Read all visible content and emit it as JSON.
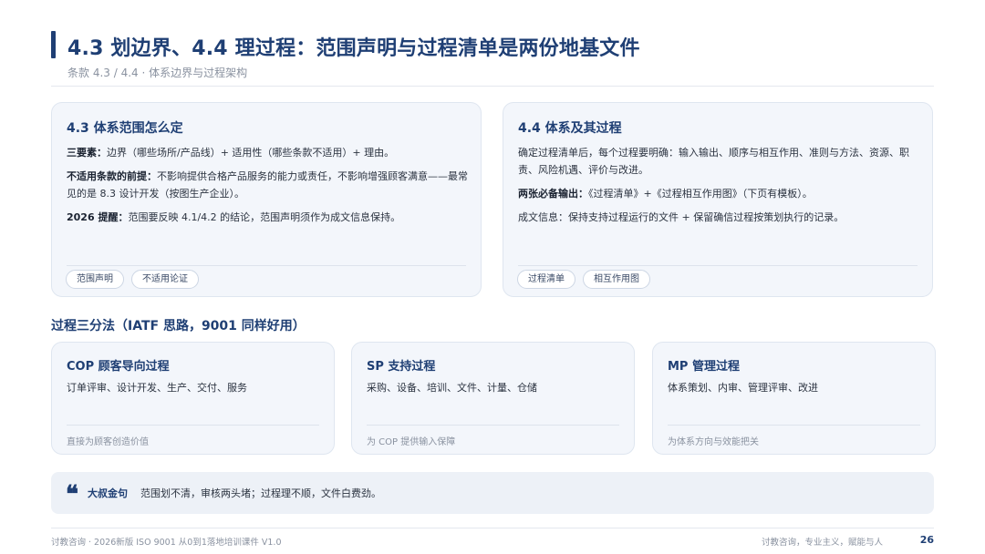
{
  "header": {
    "title": "4.3 划边界、4.4 理过程：范围声明与过程清单是两份地基文件",
    "subtitle": "条款 4.3 / 4.4 · 体系边界与过程架构"
  },
  "card_scope": {
    "title": "4.3 体系范围怎么定",
    "p1_label": "三要素：",
    "p1_text": "边界（哪些场所/产品线）+ 适用性（哪些条款不适用）+ 理由。",
    "p2_label": "不适用条款的前提：",
    "p2_text": "不影响提供合格产品服务的能力或责任，不影响增强顾客满意——最常见的是 8.3 设计开发（按图生产企业）。",
    "p3_label": "2026 提醒：",
    "p3_text": "范围要反映 4.1/4.2 的结论，范围声明须作为成文信息保持。",
    "tags": [
      "范围声明",
      "不适用论证"
    ]
  },
  "card_process": {
    "title": "4.4 体系及其过程",
    "p1_text": "确定过程清单后，每个过程要明确：输入输出、顺序与相互作用、准则与方法、资源、职责、风险机遇、评价与改进。",
    "p2_label": "两张必备输出：",
    "p2_text": "《过程清单》+《过程相互作用图》（下页有模板）。",
    "p3_text": "成文信息：保持支持过程运行的文件 + 保留确信过程按策划执行的记录。",
    "tags": [
      "过程清单",
      "相互作用图"
    ]
  },
  "section": {
    "heading": "过程三分法（IATF 思路，9001 同样好用）"
  },
  "process_types": [
    {
      "title": "COP 顾客导向过程",
      "desc": "订单评审、设计开发、生产、交付、服务",
      "foot": "直接为顾客创造价值"
    },
    {
      "title": "SP 支持过程",
      "desc": "采购、设备、培训、文件、计量、仓储",
      "foot": "为 COP 提供输入保障"
    },
    {
      "title": "MP 管理过程",
      "desc": "体系策划、内审、管理评审、改进",
      "foot": "为体系方向与效能把关"
    }
  ],
  "quote": {
    "icon": "quote-marks-icon",
    "label": "大叔金句",
    "text": "范围划不清，审核两头堵；过程理不顺，文件白费劲。"
  },
  "footer": {
    "left": "讨教咨询 · 2026新版 ISO 9001 从0到1落地培训课件 V1.0",
    "right": "讨教咨询，专业主义，赋能与人",
    "page": "26"
  },
  "colors": {
    "accent": "#1f3f74",
    "card_bg": "#f3f6fb",
    "muted": "#8a92a0"
  }
}
